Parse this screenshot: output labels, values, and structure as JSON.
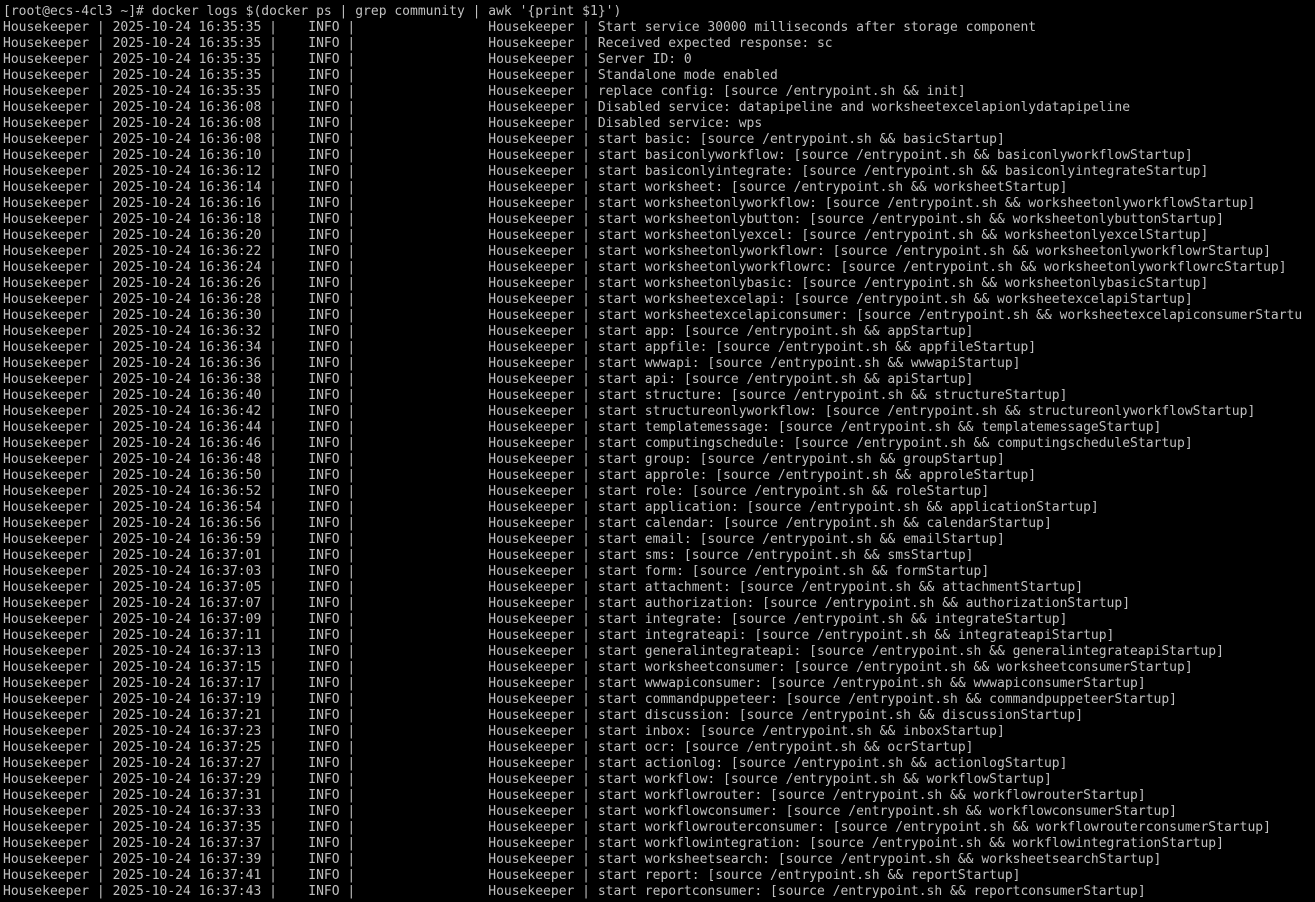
{
  "terminal": {
    "prompt": "[root@ecs-4cl3 ~]# ",
    "command": "docker logs $(docker ps | grep community | awk '{print $1}')",
    "log_lines": [
      "Housekeeper | 2025-10-24 16:35:35 |    INFO |                 Housekeeper | Start service 30000 milliseconds after storage component",
      "Housekeeper | 2025-10-24 16:35:35 |    INFO |                 Housekeeper | Received expected response: sc",
      "Housekeeper | 2025-10-24 16:35:35 |    INFO |                 Housekeeper | Server ID: 0",
      "Housekeeper | 2025-10-24 16:35:35 |    INFO |                 Housekeeper | Standalone mode enabled",
      "Housekeeper | 2025-10-24 16:35:35 |    INFO |                 Housekeeper | replace config: [source /entrypoint.sh && init]",
      "Housekeeper | 2025-10-24 16:36:08 |    INFO |                 Housekeeper | Disabled service: datapipeline and worksheetexcelapionlydatapipeline",
      "Housekeeper | 2025-10-24 16:36:08 |    INFO |                 Housekeeper | Disabled service: wps",
      "Housekeeper | 2025-10-24 16:36:08 |    INFO |                 Housekeeper | start basic: [source /entrypoint.sh && basicStartup]",
      "Housekeeper | 2025-10-24 16:36:10 |    INFO |                 Housekeeper | start basiconlyworkflow: [source /entrypoint.sh && basiconlyworkflowStartup]",
      "Housekeeper | 2025-10-24 16:36:12 |    INFO |                 Housekeeper | start basiconlyintegrate: [source /entrypoint.sh && basiconlyintegrateStartup]",
      "Housekeeper | 2025-10-24 16:36:14 |    INFO |                 Housekeeper | start worksheet: [source /entrypoint.sh && worksheetStartup]",
      "Housekeeper | 2025-10-24 16:36:16 |    INFO |                 Housekeeper | start worksheetonlyworkflow: [source /entrypoint.sh && worksheetonlyworkflowStartup]",
      "Housekeeper | 2025-10-24 16:36:18 |    INFO |                 Housekeeper | start worksheetonlybutton: [source /entrypoint.sh && worksheetonlybuttonStartup]",
      "Housekeeper | 2025-10-24 16:36:20 |    INFO |                 Housekeeper | start worksheetonlyexcel: [source /entrypoint.sh && worksheetonlyexcelStartup]",
      "Housekeeper | 2025-10-24 16:36:22 |    INFO |                 Housekeeper | start worksheetonlyworkflowr: [source /entrypoint.sh && worksheetonlyworkflowrStartup]",
      "Housekeeper | 2025-10-24 16:36:24 |    INFO |                 Housekeeper | start worksheetonlyworkflowrc: [source /entrypoint.sh && worksheetonlyworkflowrcStartup]",
      "Housekeeper | 2025-10-24 16:36:26 |    INFO |                 Housekeeper | start worksheetonlybasic: [source /entrypoint.sh && worksheetonlybasicStartup]",
      "Housekeeper | 2025-10-24 16:36:28 |    INFO |                 Housekeeper | start worksheetexcelapi: [source /entrypoint.sh && worksheetexcelapiStartup]",
      "Housekeeper | 2025-10-24 16:36:30 |    INFO |                 Housekeeper | start worksheetexcelapiconsumer: [source /entrypoint.sh && worksheetexcelapiconsumerStartu",
      "Housekeeper | 2025-10-24 16:36:32 |    INFO |                 Housekeeper | start app: [source /entrypoint.sh && appStartup]",
      "Housekeeper | 2025-10-24 16:36:34 |    INFO |                 Housekeeper | start appfile: [source /entrypoint.sh && appfileStartup]",
      "Housekeeper | 2025-10-24 16:36:36 |    INFO |                 Housekeeper | start wwwapi: [source /entrypoint.sh && wwwapiStartup]",
      "Housekeeper | 2025-10-24 16:36:38 |    INFO |                 Housekeeper | start api: [source /entrypoint.sh && apiStartup]",
      "Housekeeper | 2025-10-24 16:36:40 |    INFO |                 Housekeeper | start structure: [source /entrypoint.sh && structureStartup]",
      "Housekeeper | 2025-10-24 16:36:42 |    INFO |                 Housekeeper | start structureonlyworkflow: [source /entrypoint.sh && structureonlyworkflowStartup]",
      "Housekeeper | 2025-10-24 16:36:44 |    INFO |                 Housekeeper | start templatemessage: [source /entrypoint.sh && templatemessageStartup]",
      "Housekeeper | 2025-10-24 16:36:46 |    INFO |                 Housekeeper | start computingschedule: [source /entrypoint.sh && computingscheduleStartup]",
      "Housekeeper | 2025-10-24 16:36:48 |    INFO |                 Housekeeper | start group: [source /entrypoint.sh && groupStartup]",
      "Housekeeper | 2025-10-24 16:36:50 |    INFO |                 Housekeeper | start approle: [source /entrypoint.sh && approleStartup]",
      "Housekeeper | 2025-10-24 16:36:52 |    INFO |                 Housekeeper | start role: [source /entrypoint.sh && roleStartup]",
      "Housekeeper | 2025-10-24 16:36:54 |    INFO |                 Housekeeper | start application: [source /entrypoint.sh && applicationStartup]",
      "Housekeeper | 2025-10-24 16:36:56 |    INFO |                 Housekeeper | start calendar: [source /entrypoint.sh && calendarStartup]",
      "Housekeeper | 2025-10-24 16:36:59 |    INFO |                 Housekeeper | start email: [source /entrypoint.sh && emailStartup]",
      "Housekeeper | 2025-10-24 16:37:01 |    INFO |                 Housekeeper | start sms: [source /entrypoint.sh && smsStartup]",
      "Housekeeper | 2025-10-24 16:37:03 |    INFO |                 Housekeeper | start form: [source /entrypoint.sh && formStartup]",
      "Housekeeper | 2025-10-24 16:37:05 |    INFO |                 Housekeeper | start attachment: [source /entrypoint.sh && attachmentStartup]",
      "Housekeeper | 2025-10-24 16:37:07 |    INFO |                 Housekeeper | start authorization: [source /entrypoint.sh && authorizationStartup]",
      "Housekeeper | 2025-10-24 16:37:09 |    INFO |                 Housekeeper | start integrate: [source /entrypoint.sh && integrateStartup]",
      "Housekeeper | 2025-10-24 16:37:11 |    INFO |                 Housekeeper | start integrateapi: [source /entrypoint.sh && integrateapiStartup]",
      "Housekeeper | 2025-10-24 16:37:13 |    INFO |                 Housekeeper | start generalintegrateapi: [source /entrypoint.sh && generalintegrateapiStartup]",
      "Housekeeper | 2025-10-24 16:37:15 |    INFO |                 Housekeeper | start worksheetconsumer: [source /entrypoint.sh && worksheetconsumerStartup]",
      "Housekeeper | 2025-10-24 16:37:17 |    INFO |                 Housekeeper | start wwwapiconsumer: [source /entrypoint.sh && wwwapiconsumerStartup]",
      "Housekeeper | 2025-10-24 16:37:19 |    INFO |                 Housekeeper | start commandpuppeteer: [source /entrypoint.sh && commandpuppeteerStartup]",
      "Housekeeper | 2025-10-24 16:37:21 |    INFO |                 Housekeeper | start discussion: [source /entrypoint.sh && discussionStartup]",
      "Housekeeper | 2025-10-24 16:37:23 |    INFO |                 Housekeeper | start inbox: [source /entrypoint.sh && inboxStartup]",
      "Housekeeper | 2025-10-24 16:37:25 |    INFO |                 Housekeeper | start ocr: [source /entrypoint.sh && ocrStartup]",
      "Housekeeper | 2025-10-24 16:37:27 |    INFO |                 Housekeeper | start actionlog: [source /entrypoint.sh && actionlogStartup]",
      "Housekeeper | 2025-10-24 16:37:29 |    INFO |                 Housekeeper | start workflow: [source /entrypoint.sh && workflowStartup]",
      "Housekeeper | 2025-10-24 16:37:31 |    INFO |                 Housekeeper | start workflowrouter: [source /entrypoint.sh && workflowrouterStartup]",
      "Housekeeper | 2025-10-24 16:37:33 |    INFO |                 Housekeeper | start workflowconsumer: [source /entrypoint.sh && workflowconsumerStartup]",
      "Housekeeper | 2025-10-24 16:37:35 |    INFO |                 Housekeeper | start workflowrouterconsumer: [source /entrypoint.sh && workflowrouterconsumerStartup]",
      "Housekeeper | 2025-10-24 16:37:37 |    INFO |                 Housekeeper | start workflowintegration: [source /entrypoint.sh && workflowintegrationStartup]",
      "Housekeeper | 2025-10-24 16:37:39 |    INFO |                 Housekeeper | start worksheetsearch: [source /entrypoint.sh && worksheetsearchStartup]",
      "Housekeeper | 2025-10-24 16:37:41 |    INFO |                 Housekeeper | start report: [source /entrypoint.sh && reportStartup]",
      "Housekeeper | 2025-10-24 16:37:43 |    INFO |                 Housekeeper | start reportconsumer: [source /entrypoint.sh && reportconsumerStartup]"
    ]
  },
  "colors": {
    "background": "#000000",
    "foreground": "#c0c0c0"
  }
}
